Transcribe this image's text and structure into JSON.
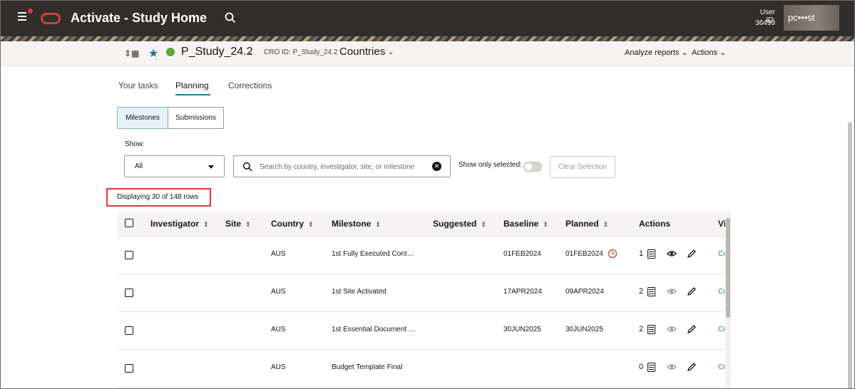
{
  "header": {
    "title": "Activate - Study Home",
    "user_id_label": "User ID:",
    "user_id": "36499",
    "user_name": "pc•••st"
  },
  "subheader": {
    "study": "P_Study_24.2",
    "cro_id": "CRO ID: P_Study_24.2",
    "scope": "Countries",
    "analyze_reports": "Analyze reports",
    "actions": "Actions"
  },
  "tabs": [
    {
      "label": "Your tasks",
      "active": false
    },
    {
      "label": "Planning",
      "active": true
    },
    {
      "label": "Corrections",
      "active": false
    }
  ],
  "segments": [
    {
      "label": "Milestones",
      "active": true
    },
    {
      "label": "Submissions",
      "active": false
    }
  ],
  "filters": {
    "show_label": "Show:",
    "show_value": "All",
    "search_placeholder": "Search by country, investigator, site, or milestone",
    "show_only_selected": "Show only selected:",
    "clear_selection": "Clear Selection"
  },
  "displaying": "Displaying 30 of 148 rows",
  "table": {
    "columns": [
      "Investigator",
      "Site",
      "Country",
      "Milestone",
      "Suggested",
      "Baseline",
      "Planned",
      "Actions",
      "Vi"
    ],
    "rows": [
      {
        "investigator": "",
        "site": "",
        "country": "AUS",
        "milestone": "1st Fully Executed Cont…",
        "suggested": "",
        "baseline": "01FEB2024",
        "planned": "01FEB2024",
        "overdue": true,
        "count": "1",
        "eye_active": true,
        "link": "Co"
      },
      {
        "investigator": "",
        "site": "",
        "country": "AUS",
        "milestone": "1st Site Activated",
        "suggested": "",
        "baseline": "17APR2024",
        "planned": "09APR2024",
        "overdue": false,
        "count": "2",
        "eye_active": false,
        "link": "Co"
      },
      {
        "investigator": "",
        "site": "",
        "country": "AUS",
        "milestone": "1st Essential Document …",
        "suggested": "",
        "baseline": "30JUN2025",
        "planned": "30JUN2025",
        "overdue": false,
        "count": "2",
        "eye_active": false,
        "link": "Co"
      },
      {
        "investigator": "",
        "site": "",
        "country": "AUS",
        "milestone": "Budget Template Final",
        "suggested": "",
        "baseline": "",
        "planned": "",
        "overdue": false,
        "count": "0",
        "eye_active": false,
        "link": "Co"
      }
    ]
  },
  "colors": {
    "header_bg": "#312d2a",
    "accent": "#227e9e",
    "highlight": "#e0383b",
    "status_green": "#5aa83c",
    "star_blue": "#1f6da6"
  }
}
